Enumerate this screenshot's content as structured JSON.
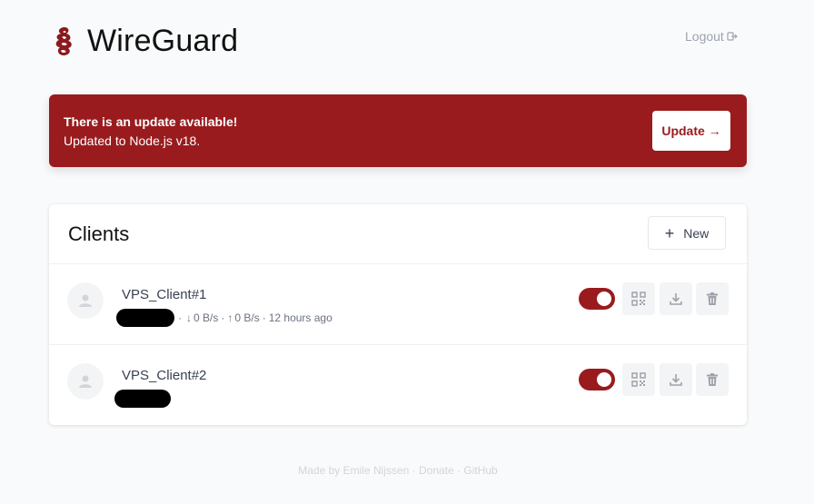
{
  "app": {
    "title": "WireGuard",
    "logo": "wireguard-dragon-logo"
  },
  "header": {
    "logout_label": "Logout",
    "logout_icon": "logout-icon"
  },
  "banner": {
    "title": "There is an update available!",
    "message": "Updated to Node.js v18.",
    "button_label": "Update →",
    "color": "#991b1e"
  },
  "clients": {
    "title": "Clients",
    "new_button_label": "New",
    "list": [
      {
        "name": "VPS_Client#1",
        "address_redacted": true,
        "separator": "·",
        "rx": "0 B/s",
        "tx": "0 B/s",
        "last_seen": "12 hours ago",
        "enabled": true
      },
      {
        "name": "VPS_Client#2",
        "address_redacted": true,
        "enabled": true
      }
    ]
  },
  "footer": {
    "made_by": "Made by Emile Nijssen",
    "sep": "·",
    "donate": "Donate",
    "github": "GitHub"
  },
  "colors": {
    "accent": "#991b1e",
    "background": "#f9fafb",
    "muted": "#9ca3af"
  }
}
